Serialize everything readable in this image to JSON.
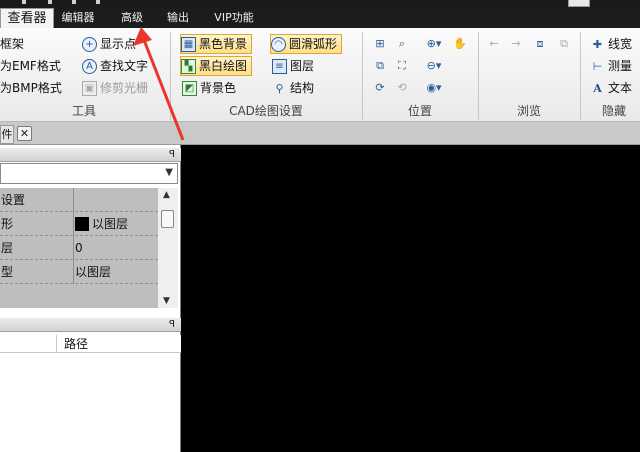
{
  "menu_tabs": [
    {
      "label": "查看器",
      "active": true
    },
    {
      "label": "编辑器",
      "active": false
    },
    {
      "label": "高级",
      "active": false
    },
    {
      "label": "输出",
      "active": false
    },
    {
      "label": "VIP功能",
      "active": false
    }
  ],
  "ribbon": {
    "tools_group": {
      "label": "工具",
      "items": [
        {
          "label": "框架",
          "icon": "frame-icon"
        },
        {
          "label": "为EMF格式",
          "icon": "emf-icon"
        },
        {
          "label": "为BMP格式",
          "icon": "bmp-icon"
        },
        {
          "label": "显示点",
          "icon": "show-points-icon"
        },
        {
          "label": "查找文字",
          "icon": "find-text-icon"
        },
        {
          "label": "修剪光栅",
          "icon": "trim-raster-icon",
          "disabled": true
        }
      ]
    },
    "cad_group": {
      "label": "CAD绘图设置",
      "items": [
        {
          "label": "黑色背景",
          "icon": "black-bg-icon",
          "highlighted": true
        },
        {
          "label": "黑白绘图",
          "icon": "bw-drawing-icon",
          "highlighted": true
        },
        {
          "label": "背景色",
          "icon": "bg-color-icon"
        },
        {
          "label": "圆滑弧形",
          "icon": "smooth-arc-icon",
          "highlighted": true
        },
        {
          "label": "图层",
          "icon": "layers-icon"
        },
        {
          "label": "结构",
          "icon": "structure-icon"
        }
      ]
    },
    "position_group": {
      "label": "位置"
    },
    "browse_group": {
      "label": "浏览"
    },
    "hide_group": {
      "label": "隐藏",
      "items": [
        {
          "label": "线宽",
          "icon": "line-width-icon"
        },
        {
          "label": "测量",
          "icon": "measure-icon"
        },
        {
          "label": "文本",
          "icon": "text-icon"
        }
      ]
    }
  },
  "doc_tab": {
    "label": "件",
    "close": "✕"
  },
  "properties": {
    "rows": [
      {
        "key": "设置",
        "value": ""
      },
      {
        "key": "形",
        "value": "以图层",
        "swatch": "#000000"
      },
      {
        "key": "层",
        "value": "0"
      },
      {
        "key": "型",
        "value": "以图层"
      }
    ]
  },
  "file_list": {
    "column_path": "路径"
  },
  "colors": {
    "annotation_arrow": "#e8362a",
    "canvas": "#000000",
    "highlight": "#fddf86"
  }
}
